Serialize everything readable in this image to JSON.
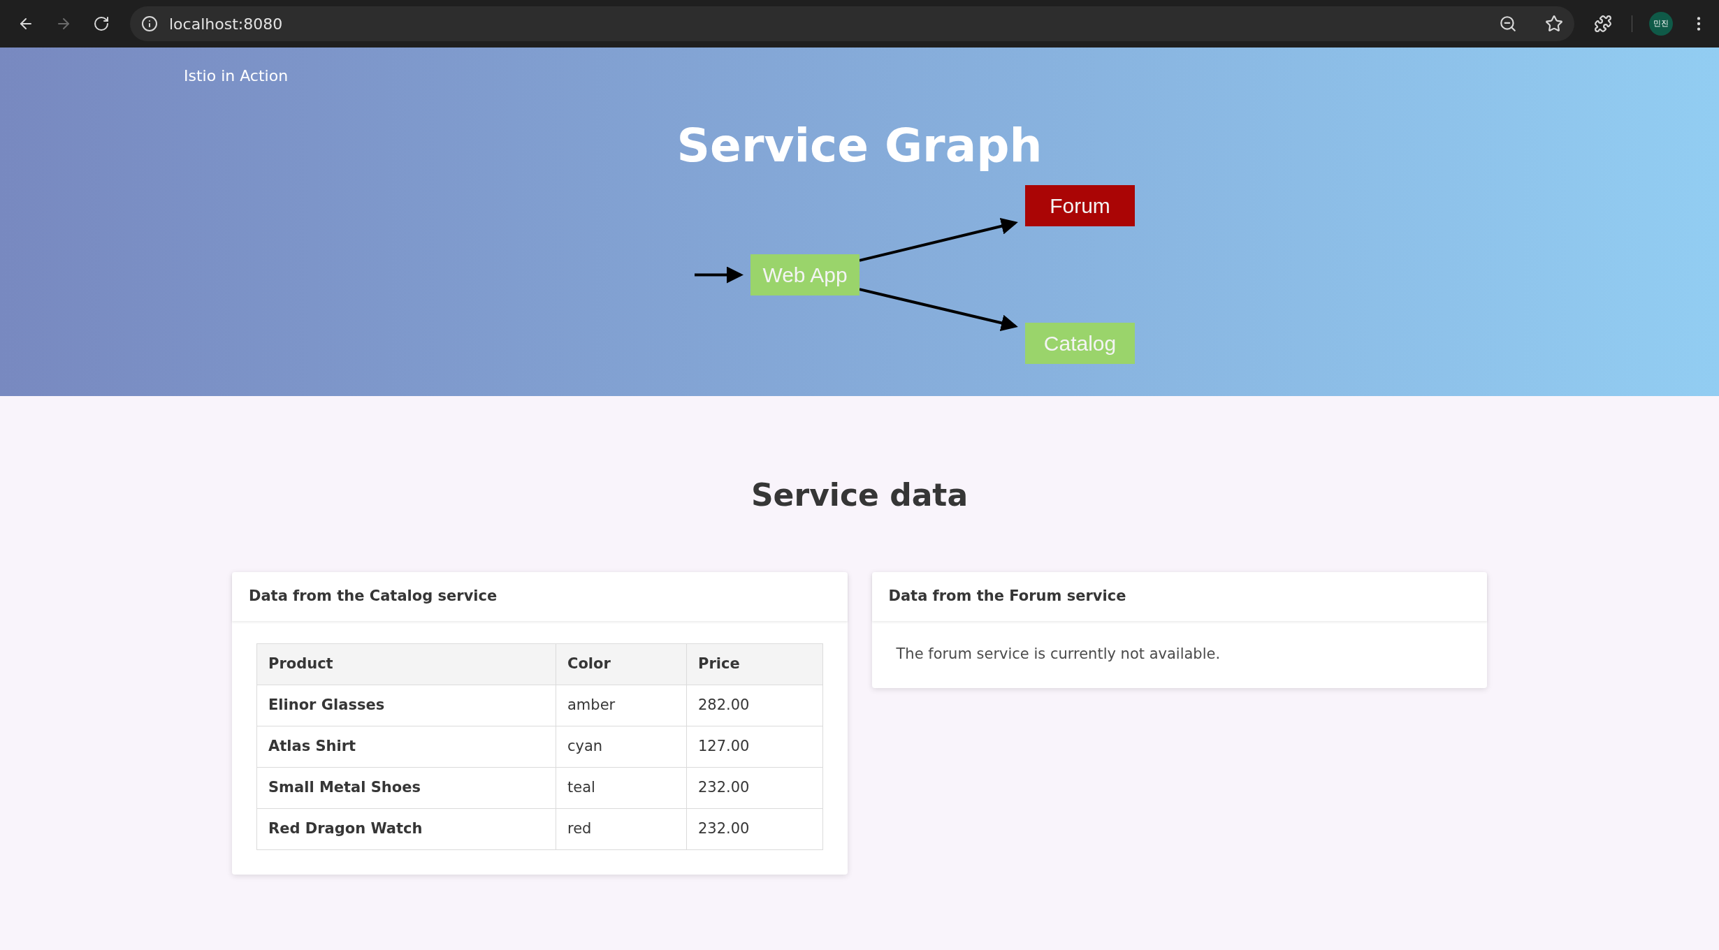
{
  "browser": {
    "nav": [
      {
        "kind": "back",
        "disabled": false
      },
      {
        "kind": "forward",
        "disabled": true
      },
      {
        "kind": "reload",
        "disabled": false
      }
    ],
    "url": "localhost:8080",
    "profile": "민진"
  },
  "header": {
    "brand": "Istio in Action",
    "title": "Service Graph"
  },
  "graph": {
    "nodes": [
      {
        "label": "Forum",
        "healthy": false
      },
      {
        "label": "Web App",
        "healthy": true
      },
      {
        "label": "Catalog",
        "healthy": true
      }
    ]
  },
  "section_title": "Service data",
  "catalog_card": {
    "title": "Data from the Catalog service",
    "columns": [
      "Product",
      "Color",
      "Price"
    ],
    "rows": [
      [
        "Elinor Glasses",
        "amber",
        "282.00"
      ],
      [
        "Atlas Shirt",
        "cyan",
        "127.00"
      ],
      [
        "Small Metal Shoes",
        "teal",
        "232.00"
      ],
      [
        "Red Dragon Watch",
        "red",
        "232.00"
      ]
    ]
  },
  "forum_card": {
    "title": "Data from the Forum service",
    "message": "The forum service is currently not available."
  }
}
